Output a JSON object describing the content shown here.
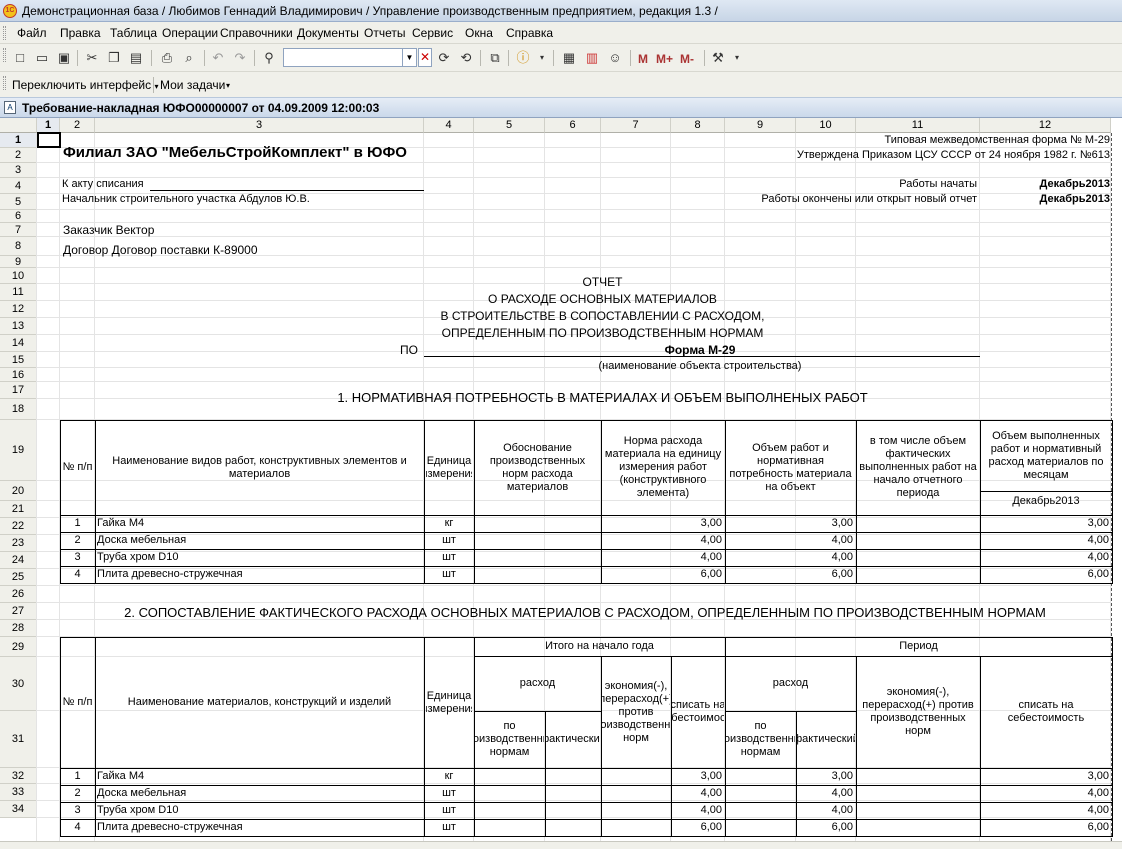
{
  "window": {
    "title": "Демонстрационная база / Любимов Геннадий Владимирович / Управление производственным предприятием, редакция 1.3 /",
    "logo": "1С"
  },
  "menu": [
    "Файл",
    "Правка",
    "Таблица",
    "Операции",
    "Справочники",
    "Документы",
    "Отчеты",
    "Сервис",
    "Окна",
    "Справка"
  ],
  "toolbar": {
    "search_value": "",
    "m_label": "M",
    "mplus_label": "M+",
    "mminus_label": "M-"
  },
  "toolbar2": {
    "switch_interface": "Переключить интерфейс",
    "my_tasks": "Мои задачи"
  },
  "document": {
    "title": "Требование-накладная ЮФО00000007 от 04.09.2009 12:00:03"
  },
  "sheet": {
    "col_headers": [
      "1",
      "2",
      "3",
      "4",
      "5",
      "6",
      "7",
      "8",
      "9",
      "10",
      "11",
      "12"
    ],
    "row_numbers": [
      "1",
      "2",
      "3",
      "4",
      "5",
      "6",
      "7",
      "8",
      "9",
      "10",
      "11",
      "12",
      "13",
      "14",
      "15",
      "16",
      "17",
      "18",
      "19",
      "20",
      "21",
      "22",
      "23",
      "24",
      "25",
      "26",
      "27",
      "28",
      "29",
      "30",
      "31",
      "32",
      "33",
      "34"
    ],
    "form_type": "Типовая межведомственная форма  № М-29",
    "approved": "Утверждена Приказом ЦСУ СССР от 24 ноября 1982 г. №613",
    "org_name": "Филиал ЗАО \"МебельСтройКомплект\" в ЮФО",
    "act_label": "К акту списания",
    "chief": "Начальник строительного участка Абдулов Ю.В.",
    "works_started_label": "Работы начаты",
    "works_started_value": "Декабрь2013",
    "works_finished_label": "Работы окончены или открыт новый отчет",
    "works_finished_value": "Декабрь2013",
    "customer": "Заказчик Вектор",
    "contract": "Договор Договор поставки К-89000",
    "report_lines": [
      "ОТЧЕТ",
      "О РАСХОДЕ ОСНОВНЫХ МАТЕРИАЛОВ",
      "В СТРОИТЕЛЬСТВЕ В СОПОСТАВЛЕНИИ С РАСХОДОМ,",
      "ОПРЕДЕЛЕННЫМ ПО ПРОИЗВОДСТВЕННЫМ НОРМАМ"
    ],
    "po_label": "ПО",
    "form_name": "Форма М-29",
    "object_hint": "(наименование объекта строительства)",
    "section1_title": "1. НОРМАТИВНАЯ ПОТРЕБНОСТЬ В МАТЕРИАЛАХ И ОБЪЕМ ВЫПОЛНЕНЫХ РАБОТ",
    "table1_headers": {
      "num": "№ п/п",
      "name": "Наименование видов работ, конструктивных элементов и материалов",
      "unit": "Единица измерения",
      "basis": "Обоснование производственных норм расхода материалов",
      "norm": "Норма расхода материала на единицу измерения работ (конструктивного элемента)",
      "volume": "Объем работ и нормативная потребность материала на объект",
      "incl": "в том числе объем фактических выполненных работ на начало отчетного периода",
      "monthly": "Объем выполненных работ и нормативный расход материалов по месяцам",
      "month": "Декабрь2013"
    },
    "table1_rows": [
      {
        "num": "1",
        "name": "Гайка М4",
        "unit": "кг",
        "norm": "3,00",
        "volume": "3,00",
        "monthly": "3,00"
      },
      {
        "num": "2",
        "name": "Доска мебельная",
        "unit": "шт",
        "norm": "4,00",
        "volume": "4,00",
        "monthly": "4,00"
      },
      {
        "num": "3",
        "name": "Труба хром D10",
        "unit": "шт",
        "norm": "4,00",
        "volume": "4,00",
        "monthly": "4,00"
      },
      {
        "num": "4",
        "name": "Плита древесно-стружечная",
        "unit": "шт",
        "norm": "6,00",
        "volume": "6,00",
        "monthly": "6,00"
      }
    ],
    "section2_title": "2. СОПОСТАВЛЕНИЕ ФАКТИЧЕСКОГО РАСХОДА ОСНОВНЫХ МАТЕРИАЛОВ С РАСХОДОМ, ОПРЕДЕЛЕННЫМ ПО ПРОИЗВОДСТВЕННЫМ НОРМАМ",
    "table2_headers": {
      "num": "№ п/п",
      "name": "Наименование материалов, конструкций и изделий",
      "unit": "Единица измерения",
      "total_start": "Итого на начало года",
      "period": "Период",
      "consumption": "расход",
      "economy": "экономия(-), перерасход(+) против производственных норм",
      "writeoff": "списать на себестоимость",
      "by_norms": "по производственным нормам",
      "actual": "фактический",
      "economy2": "экономия(-), перерасход(+) против производственных норм",
      "writeoff2": "списать на себестоимость"
    },
    "table2_rows": [
      {
        "num": "1",
        "name": "Гайка М4",
        "unit": "кг",
        "a": "3,00",
        "b": "3,00",
        "c": "3,00"
      },
      {
        "num": "2",
        "name": "Доска мебельная",
        "unit": "шт",
        "a": "4,00",
        "b": "4,00",
        "c": "4,00"
      },
      {
        "num": "3",
        "name": "Труба хром D10",
        "unit": "шт",
        "a": "4,00",
        "b": "4,00",
        "c": "4,00"
      },
      {
        "num": "4",
        "name": "Плита древесно-стружечная",
        "unit": "шт",
        "a": "6,00",
        "b": "6,00",
        "c": "6,00"
      }
    ]
  }
}
